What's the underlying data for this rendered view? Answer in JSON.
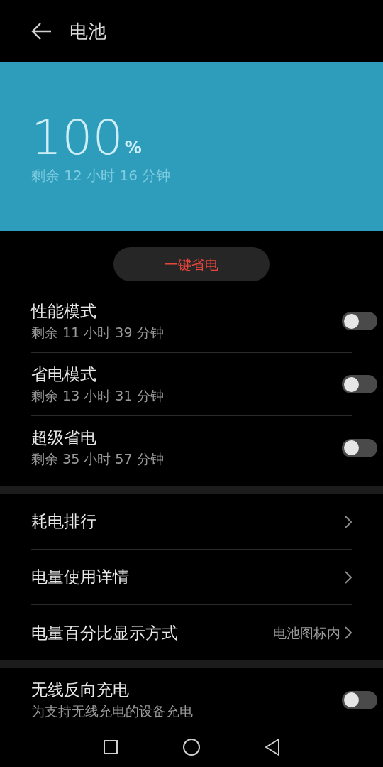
{
  "header": {
    "title": "电池"
  },
  "battery": {
    "percent": "100",
    "unit": "%",
    "remaining": "剩余 12 小时 16 分钟"
  },
  "save_button": "一键省电",
  "modes": [
    {
      "title": "性能模式",
      "subtitle": "剩余 11 小时 39 分钟",
      "on": false
    },
    {
      "title": "省电模式",
      "subtitle": "剩余 13 小时 31 分钟",
      "on": false
    },
    {
      "title": "超级省电",
      "subtitle": "剩余 35 小时 57 分钟",
      "on": false
    }
  ],
  "links": [
    {
      "label": "耗电排行"
    },
    {
      "label": "电量使用详情"
    },
    {
      "label": "电量百分比显示方式",
      "value": "电池图标内"
    }
  ],
  "wireless": {
    "title": "无线反向充电",
    "subtitle": "为支持无线充电的设备充电",
    "on": false
  }
}
